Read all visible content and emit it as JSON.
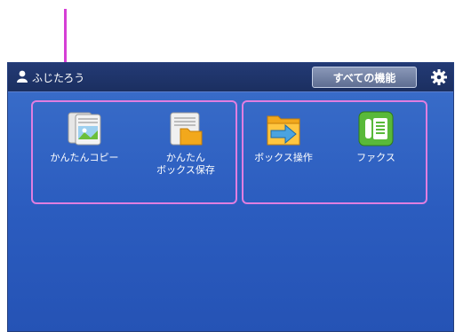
{
  "topbar": {
    "username": "ふじたろう",
    "all_functions_label": "すべての機能"
  },
  "apps": [
    {
      "label": "かんたんコピー",
      "icon": "easy-copy-icon"
    },
    {
      "label": "かんたん\nボックス保存",
      "icon": "easy-box-save-icon"
    },
    {
      "label": "ボックス操作",
      "icon": "box-operation-icon"
    },
    {
      "label": "ファクス",
      "icon": "fax-icon"
    }
  ],
  "colors": {
    "accent_callout": "#d63fd6",
    "screen_blue": "#2b5cbf",
    "topbar": "#1b2f60"
  }
}
